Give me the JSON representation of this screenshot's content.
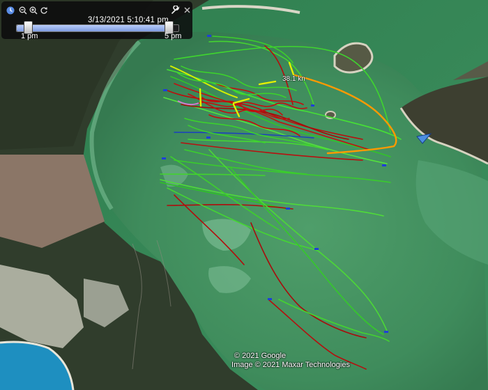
{
  "toolbar": {
    "date_time": "3/13/2021   5:10:41 pm",
    "start_label": "1 pm",
    "end_label": "5 pm",
    "progress": 0.94
  },
  "map": {
    "speed_label": "38.1 kn"
  },
  "attribution": {
    "line1": "© 2021 Google",
    "line2": "Image © 2021 Maxar Technologies"
  },
  "icons": [
    "clock-icon",
    "zoom-out-icon",
    "zoom-in-icon",
    "refresh-icon",
    "wrench-icon",
    "close-icon"
  ],
  "colors": {
    "water": "#3c8c5a",
    "shallow": "#6fb58a",
    "land_forest": "#2f3b2a",
    "sand": "#d9d8cc",
    "farm": "#8a7566",
    "track_fast": "#d4f000",
    "track_mid": "#44dd33",
    "track_slow": "#b30000",
    "track_highlight": "#ff9a00",
    "boat_marker": "#4b8fe0"
  }
}
